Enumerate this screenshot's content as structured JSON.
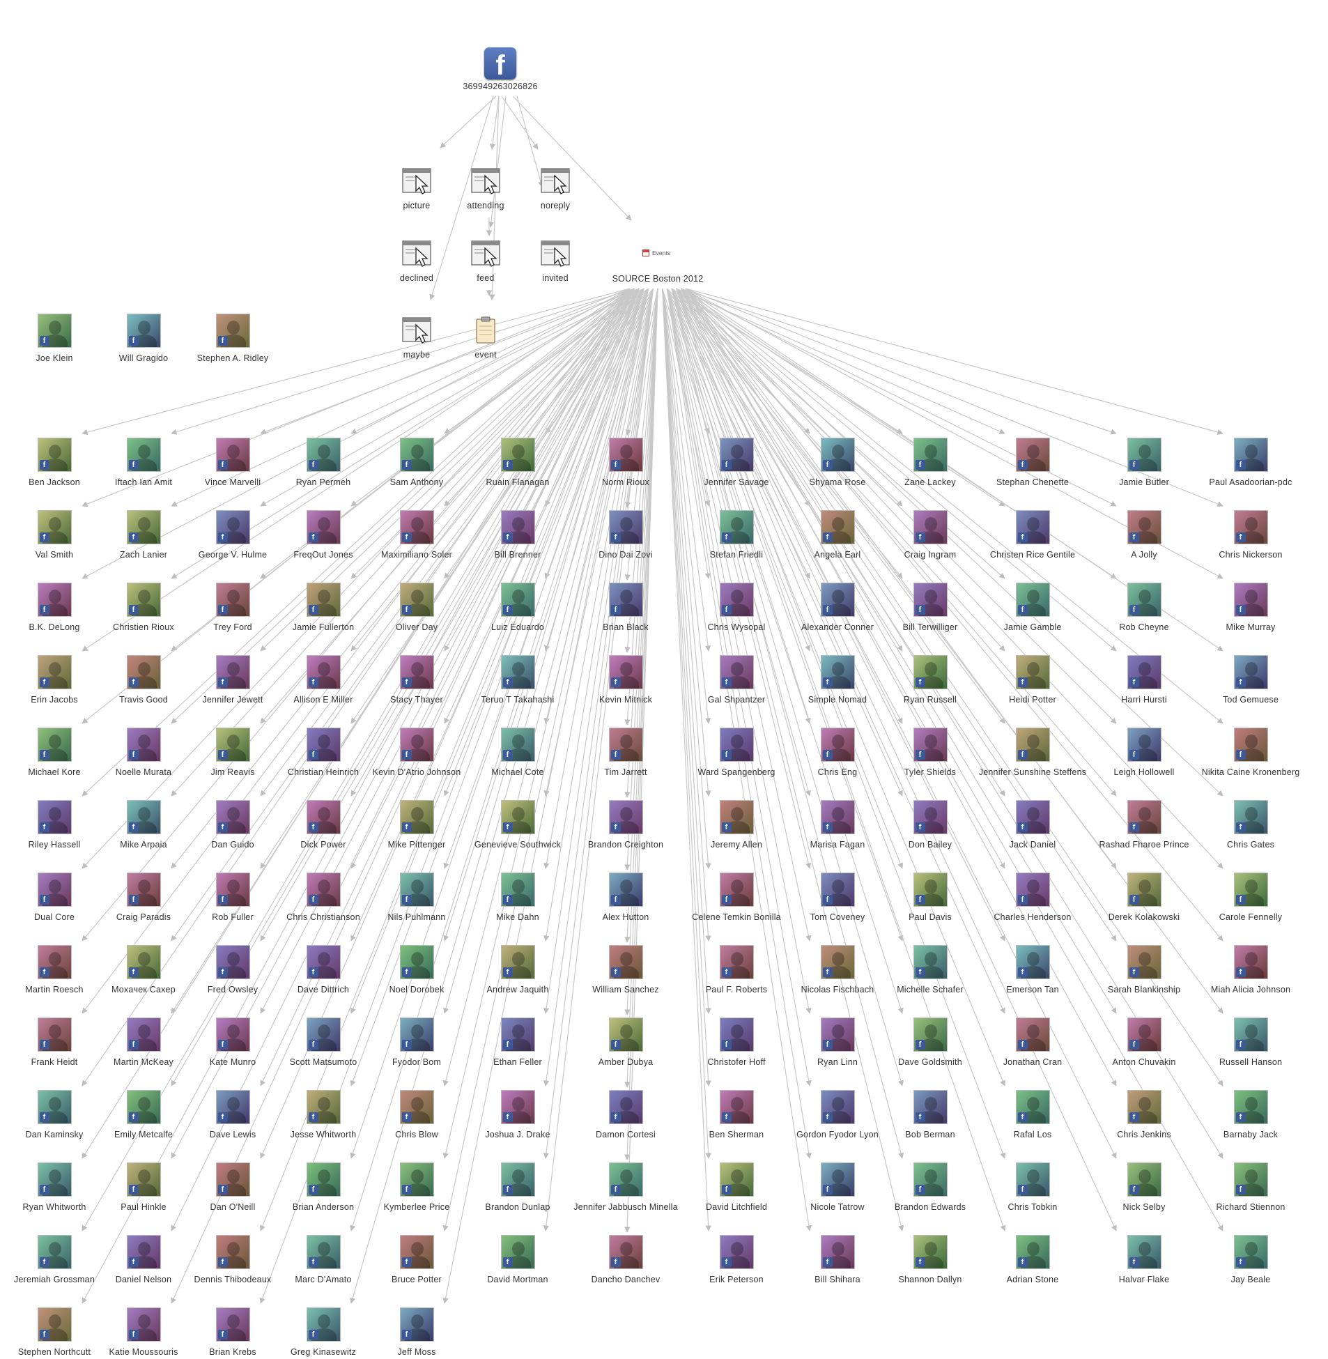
{
  "root": {
    "label": "369949263026826",
    "icon": "facebook-icon"
  },
  "connections": [
    {
      "key": "picture",
      "label": "picture",
      "icon": "window-cursor-icon"
    },
    {
      "key": "attending",
      "label": "attending",
      "icon": "window-cursor-icon"
    },
    {
      "key": "noreply",
      "label": "noreply",
      "icon": "window-cursor-icon"
    },
    {
      "key": "declined",
      "label": "declined",
      "icon": "window-cursor-icon"
    },
    {
      "key": "feed",
      "label": "feed",
      "icon": "window-cursor-icon"
    },
    {
      "key": "invited",
      "label": "invited",
      "icon": "window-cursor-icon"
    },
    {
      "key": "maybe",
      "label": "maybe",
      "icon": "window-cursor-icon"
    },
    {
      "key": "event",
      "label": "event",
      "icon": "clipboard-icon"
    }
  ],
  "event": {
    "category": "Events",
    "label": "SOURCE Boston 2012",
    "icon": "calendar-icon"
  },
  "isolated_people": [
    "Joe Klein",
    "Will Gragido",
    "Stephen A. Ridley"
  ],
  "attendees": [
    [
      "Ben Jackson",
      "Iftach Ian Amit",
      "Vince Marvelli",
      "Ryan Permeh",
      "Sam Anthony",
      "Ruain Flanagan",
      "Norm Rioux",
      "Jennifer Savage",
      "Shyama Rose",
      "Zane Lackey",
      "Stephan Chenette",
      "Jamie Butler",
      "Paul Asadoorian-pdc"
    ],
    [
      "Val Smith",
      "Zach Lanier",
      "George V. Hulme",
      "FreqOut Jones",
      "Maximiliano Soler",
      "Bill Brenner",
      "Dino Dai Zovi",
      "Stefan Friedli",
      "Angela Earl",
      "Craig Ingram",
      "Christen Rice Gentile",
      "A Jolly",
      "Chris Nickerson"
    ],
    [
      "B.K. DeLong",
      "Christien Rioux",
      "Trey Ford",
      "Jamie Fullerton",
      "Oliver Day",
      "Luiz Eduardo",
      "Brian Black",
      "Chris Wysopal",
      "Alexander Conner",
      "Bill Terwilliger",
      "Jamie Gamble",
      "Rob Cheyne",
      "Mike Murray"
    ],
    [
      "Erin Jacobs",
      "Travis Good",
      "Jennifer Jewett",
      "Allison E Miller",
      "Stacy Thayer",
      "Teruo T Takahashi",
      "Kevin Mitnick",
      "Gal Shpantzer",
      "Simple Nomad",
      "Ryan Russell",
      "Heidi Potter",
      "Harri Hursti",
      "Tod Gemuese"
    ],
    [
      "Michael Kore",
      "Noelle Murata",
      "Jim Reavis",
      "Christian Heinrich",
      "Kevin D'Atrio Johnson",
      "Michael Cote",
      "Tim Jarrett",
      "Ward Spangenberg",
      "Chris Eng",
      "Tyler Shields",
      "Jennifer Sunshine Steffens",
      "Leigh Hollowell",
      "Nikita Caine Kronenberg"
    ],
    [
      "Riley Hassell",
      "Mike Arpaia",
      "Dan Guido",
      "Dick Power",
      "Mike Pittenger",
      "Genevieve Southwick",
      "Brandon Creighton",
      "Jeremy Allen",
      "Marisa Fagan",
      "Don Bailey",
      "Jack Daniel",
      "Rashad Fharoe Prince",
      "Chris Gates"
    ],
    [
      "Dual Core",
      "Craig Paradis",
      "Rob Fuller",
      "Chris Christianson",
      "Nils Puhlmann",
      "Mike Dahn",
      "Alex Hutton",
      "Celene Temkin Bonilla",
      "Tom Coveney",
      "Paul Davis",
      "Charles Henderson",
      "Derek Kolakowski",
      "Carole Fennelly"
    ],
    [
      "Martin Roesch",
      "Moxaчeк Caxep",
      "Fred Owsley",
      "Dave Dittrich",
      "Noel Dorobek",
      "Andrew Jaquith",
      "William Sanchez",
      "Paul F. Roberts",
      "Nicolas Fischbach",
      "Michelle Schafer",
      "Emerson Tan",
      "Sarah Blankinship",
      "Miah Alicia Johnson"
    ],
    [
      "Frank Heidt",
      "Martin McKeay",
      "Kate Munro",
      "Scott Matsumoto",
      "Fyodor Bom",
      "Ethan Feller",
      "Amber Dubya",
      "Christofer Hoff",
      "Ryan Linn",
      "Dave Goldsmith",
      "Jonathan Cran",
      "Anton Chuvakin",
      "Russell Hanson"
    ],
    [
      "Dan Kaminsky",
      "Emily Metcalfe",
      "Dave Lewis",
      "Jesse Whitworth",
      "Chris Blow",
      "Joshua J. Drake",
      "Damon Cortesi",
      "Ben Sherman",
      "Gordon Fyodor Lyon",
      "Bob Berman",
      "Rafal Los",
      "Chris Jenkins",
      "Barnaby Jack"
    ],
    [
      "Ryan Whitworth",
      "Paul Hinkle",
      "Dan O'Neill",
      "Brian Anderson",
      "Kymberlee Price",
      "Brandon Dunlap",
      "Jennifer Jabbusch Minella",
      "David Litchfield",
      "Nicole Tatrow",
      "Brandon Edwards",
      "Chris Tobkin",
      "Nick Selby",
      "Richard Stiennon"
    ],
    [
      "Jeremiah Grossman",
      "Daniel Nelson",
      "Dennis Thibodeaux",
      "Marc D'Amato",
      "Bruce Potter",
      "David Mortman",
      "Dancho Danchev",
      "Erik Peterson",
      "Bill Shihara",
      "Shannon Dallyn",
      "Adrian Stone",
      "Halvar Flake",
      "Jay Beale"
    ],
    [
      "Stephen Northcutt",
      "Katie Moussouris",
      "Brian Krebs",
      "Greg Kinasewitz",
      "Jeff Moss"
    ]
  ],
  "colors": {
    "edge": "#c8c8c8",
    "label": "#333333",
    "facebook_blue": "#3b5998"
  }
}
